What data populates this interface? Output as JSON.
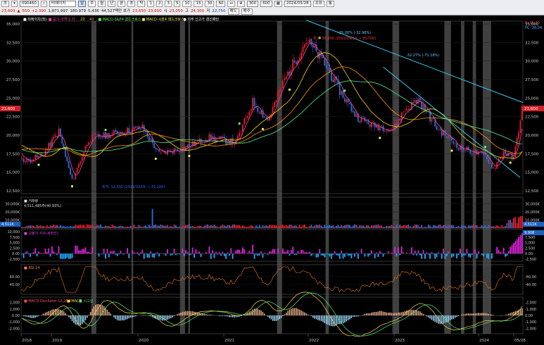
{
  "toolbar": {
    "code": "090460",
    "name": "비에이치",
    "periods": [
      "일",
      "주",
      "월",
      "년",
      "분",
      "초",
      "틱"
    ],
    "period_active": "일",
    "counts": [
      "1",
      "2",
      "3",
      "5",
      "10",
      "15",
      "30",
      "60"
    ],
    "range": "300",
    "range2": "600",
    "date": "2024/05/28",
    "buttons": [
      "조회",
      "통"
    ],
    "quote": {
      "price": "23,600",
      "arrow": "▲",
      "change": "550",
      "pct": "+2.390",
      "volume": "1,871,997",
      "vol_ratio": "180.979",
      "value": "5,436",
      "item1": "44,527백만 호가",
      "p1": "23,650",
      "p2": "23,600",
      "open_lbl": "시",
      "open": "23,050",
      "high_lbl": "고",
      "high": "24,300",
      "low_lbl": "저",
      "low": "22,750",
      "extra": "매도",
      "extra2": "매수"
    }
  },
  "price_panel": {
    "legend": [
      "■ 비에이치(좌)",
      "■ 공기-가격 1.7)",
      "20",
      "40",
      "■ MACD-S&P4 골든크로스",
      "■ MACD-시장4 데드크로스",
      "● 의주 신고가 갱신패턴"
    ],
    "legend_colors": [
      "#ffffff",
      "#ff44aa",
      "#ffd700",
      "#ff9900",
      "#66ff66",
      "#ffee55",
      "#ffffff"
    ],
    "yticks": [
      "35,000",
      "32,500",
      "30,000",
      "27,500",
      "25,000",
      "22,500",
      "20,000",
      "17,500",
      "15,000",
      "12,500"
    ],
    "yticks_right": [
      "35,000",
      "32,500",
      "30,000",
      "27,500",
      "25,000",
      "22,500",
      "20,000",
      "17,500",
      "15,000",
      "12,500"
    ],
    "top_right1": "E: 35,70",
    "top_right2": "PC: 36,04",
    "current_label": "23,600",
    "ann_high": "최고: 36,550 (2022/04/13 → 35,700)",
    "ann_mid": "-35.00%  (-32.96%)",
    "ann_right": "-32.27% (-71.18%)",
    "ann_low": "최저: 12,500 (2019/10/01 → 25,100)"
  },
  "volume_panel": {
    "title": "■ 거래량",
    "value": "4,511,485주(40.93%)",
    "yticks": [
      "30,000K",
      "20,000K",
      "10,000K"
    ],
    "current_label": "4,511K"
  },
  "forcing_panel": {
    "title": "■ 고물가 지수(세력선)",
    "yticks": [
      "10,000",
      "7,500",
      "5,000",
      "2,500",
      "0.00",
      "-2,500"
    ],
    "current_label": "9,908"
  },
  "rsi_panel": {
    "title": "■ RSI 14",
    "yticks": [
      "60.00",
      "40.00"
    ],
    "yticks_right": [
      "-60.00",
      "-40.00"
    ]
  },
  "macd_panel": {
    "title": "■ MACD Oscillator 12,26,9",
    "macd_lbl": "■ MACD",
    "signal_lbl": "■ 시그널",
    "yticks": [
      "2,000",
      "1,000",
      "0.00",
      "-1,000",
      "-2,000"
    ],
    "yticks_right": [
      "-2,000",
      "-1,000",
      "0.00",
      "-1,000",
      "-2,000"
    ]
  },
  "xaxis": [
    "2018",
    "2019",
    "2020",
    "2021",
    "2022",
    "2023",
    "2024",
    "05/28"
  ],
  "colors": {
    "up": "#e6202a",
    "down": "#2b6fd6",
    "bg": "#000000",
    "shade": "#555555",
    "trend": "#33ccee"
  }
}
